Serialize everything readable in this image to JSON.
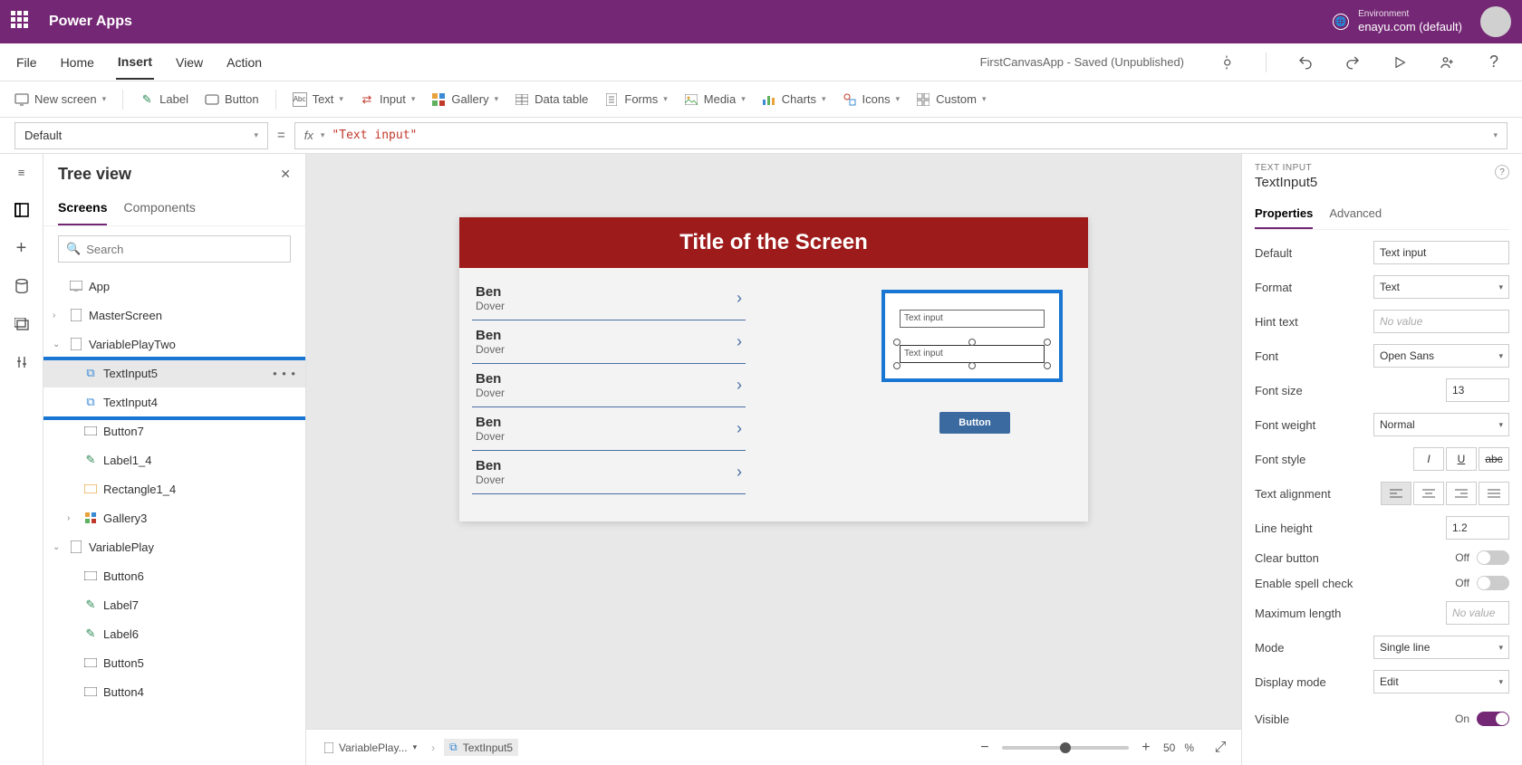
{
  "topbar": {
    "app_title": "Power Apps",
    "env_label": "Environment",
    "env_name": "enayu.com (default)"
  },
  "menubar": {
    "items": [
      "File",
      "Home",
      "Insert",
      "View",
      "Action"
    ],
    "active_index": 2,
    "app_status": "FirstCanvasApp - Saved (Unpublished)"
  },
  "ribbon": {
    "new_screen": "New screen",
    "items": [
      "Label",
      "Button",
      "Text",
      "Input",
      "Gallery",
      "Data table",
      "Forms",
      "Media",
      "Charts",
      "Icons",
      "Custom"
    ]
  },
  "formula": {
    "property": "Default",
    "value": "\"Text input\""
  },
  "tree": {
    "title": "Tree view",
    "tabs": [
      "Screens",
      "Components"
    ],
    "active_tab": 0,
    "search_placeholder": "Search",
    "nodes": [
      {
        "label": "App",
        "level": 0,
        "icon": "app"
      },
      {
        "label": "MasterScreen",
        "level": 0,
        "icon": "screen",
        "caret": "›"
      },
      {
        "label": "VariablePlayTwo",
        "level": 0,
        "icon": "screen",
        "caret": "⌄"
      },
      {
        "label": "TextInput5",
        "level": 1,
        "icon": "input",
        "selected": true,
        "more": true,
        "hl": "top"
      },
      {
        "label": "TextInput4",
        "level": 1,
        "icon": "input",
        "hl": "bottom"
      },
      {
        "label": "Button7",
        "level": 1,
        "icon": "button"
      },
      {
        "label": "Label1_4",
        "level": 1,
        "icon": "label"
      },
      {
        "label": "Rectangle1_4",
        "level": 1,
        "icon": "rect"
      },
      {
        "label": "Gallery3",
        "level": 1,
        "icon": "gallery",
        "caret": "›"
      },
      {
        "label": "VariablePlay",
        "level": 0,
        "icon": "screen",
        "caret": "⌄"
      },
      {
        "label": "Button6",
        "level": 1,
        "icon": "button"
      },
      {
        "label": "Label7",
        "level": 1,
        "icon": "label"
      },
      {
        "label": "Label6",
        "level": 1,
        "icon": "label"
      },
      {
        "label": "Button5",
        "level": 1,
        "icon": "button"
      },
      {
        "label": "Button4",
        "level": 1,
        "icon": "button"
      }
    ]
  },
  "canvas": {
    "screen_title": "Title of the Screen",
    "gallery_rows": [
      {
        "name": "Ben",
        "sub": "Dover"
      },
      {
        "name": "Ben",
        "sub": "Dover"
      },
      {
        "name": "Ben",
        "sub": "Dover"
      },
      {
        "name": "Ben",
        "sub": "Dover"
      },
      {
        "name": "Ben",
        "sub": "Dover"
      }
    ],
    "input1": "Text input",
    "input2": "Text input",
    "button_label": "Button",
    "breadcrumb1": "VariablePlay...",
    "breadcrumb2": "TextInput5",
    "zoom_value": "50",
    "zoom_unit": "%"
  },
  "props": {
    "type_label": "TEXT INPUT",
    "name": "TextInput5",
    "tabs": [
      "Properties",
      "Advanced"
    ],
    "active_tab": 0,
    "rows": {
      "default_l": "Default",
      "default_v": "Text input",
      "format_l": "Format",
      "format_v": "Text",
      "hint_l": "Hint text",
      "hint_v": "No value",
      "font_l": "Font",
      "font_v": "Open Sans",
      "size_l": "Font size",
      "size_v": "13",
      "weight_l": "Font weight",
      "weight_v": "Normal",
      "style_l": "Font style",
      "align_l": "Text alignment",
      "lh_l": "Line height",
      "lh_v": "1.2",
      "clear_l": "Clear button",
      "clear_v": "Off",
      "spell_l": "Enable spell check",
      "spell_v": "Off",
      "maxlen_l": "Maximum length",
      "maxlen_v": "No value",
      "mode_l": "Mode",
      "mode_v": "Single line",
      "disp_l": "Display mode",
      "disp_v": "Edit",
      "vis_l": "Visible",
      "vis_v": "On"
    }
  }
}
